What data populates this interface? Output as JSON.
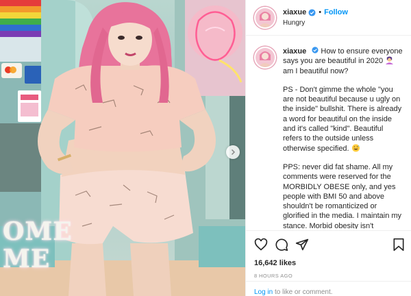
{
  "post": {
    "username": "xiaxue",
    "follow_label": "Follow",
    "separator": "•",
    "location": "Hungry",
    "verified_icon": "verified-badge-icon",
    "caption": {
      "part1_before_emoji": "How to ensure everyone says you are beautiful in 2020",
      "part1_after_emoji": "am I beautiful now?",
      "paragraph2": "PS - Don't gimme the whole \"you are not beautiful because u ugly on the inside\" bullshit. There is already a word for beautiful on the inside and it's called \"kind\". Beautiful refers to the outside unless otherwise specified.",
      "paragraph3": "PPS: never did fat shame. All my comments were reserved for the MORBIDLY OBESE only, and yes people with BMI 50 and above shouldn't be romanticized or glorified in the media. I maintain my stance. Morbid obesity isn't attractive because it leads to death and disease. This isn't personal against anyone so it isn't fat"
    },
    "likes": "16,642 likes",
    "time_ago": "8 HOURS AGO",
    "login_link": "Log in",
    "login_rest": " to like or comment."
  },
  "photo": {
    "sign_line1": "OME",
    "sign_line2": "ME"
  },
  "icons": {
    "like": "heart-icon",
    "comment": "comment-icon",
    "share": "share-icon",
    "save": "bookmark-icon",
    "next": "chevron-right-icon"
  },
  "colors": {
    "link_blue": "#0095f6",
    "muted": "#8e8e8e",
    "hair_pink": "#ea6f99",
    "outfit_pink": "#f6d2c4"
  }
}
